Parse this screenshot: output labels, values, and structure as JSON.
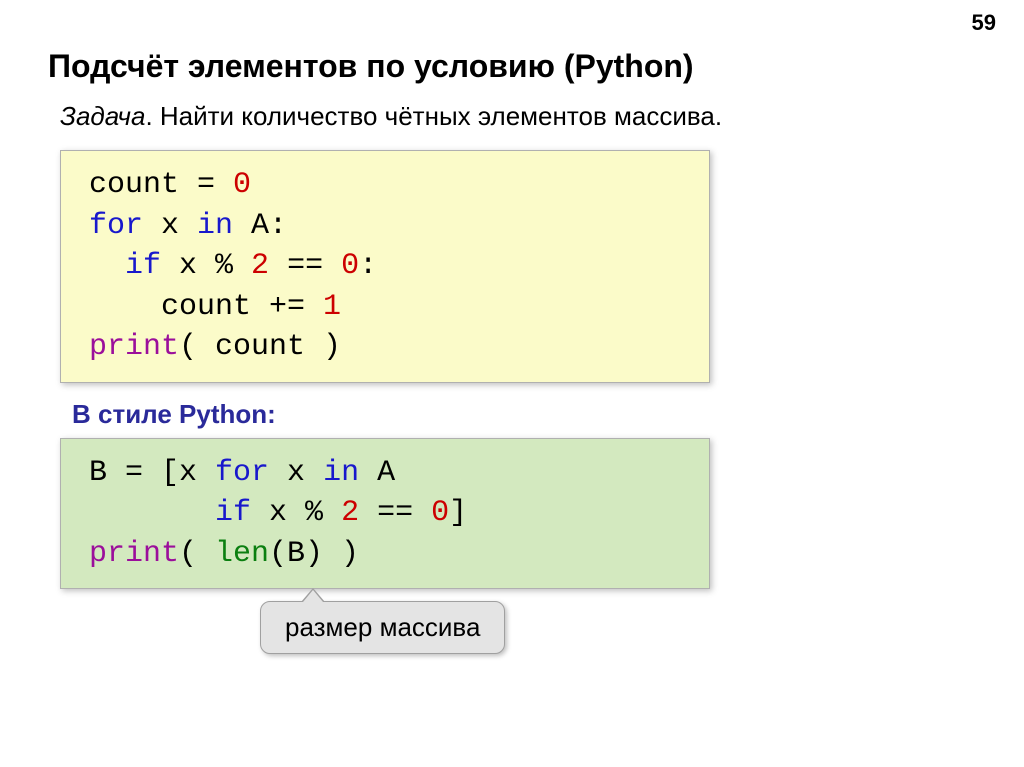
{
  "page_number": "59",
  "title": "Подсчёт элементов по условию (Python)",
  "task_label": "Задача",
  "task_text": ". Найти количество чётных элементов массива.",
  "code1": {
    "l1_a": "count = ",
    "l1_b": "0",
    "l2_a": "for",
    "l2_b": " x ",
    "l2_c": "in",
    "l2_d": " A:",
    "l3_a": "  ",
    "l3_b": "if",
    "l3_c": " x % ",
    "l3_d": "2",
    "l3_e": " == ",
    "l3_f": "0",
    "l3_g": ":",
    "l4_a": "    count += ",
    "l4_b": "1",
    "l5_a": "print",
    "l5_b": "( count )"
  },
  "subtitle": "В стиле Python:",
  "code2": {
    "l1_a": "B = [x ",
    "l1_b": "for",
    "l1_c": " x ",
    "l1_d": "in",
    "l1_e": " A",
    "l2_a": "       ",
    "l2_b": "if",
    "l2_c": " x % ",
    "l2_d": "2",
    "l2_e": " == ",
    "l2_f": "0",
    "l2_g": "]",
    "l3_a": "print",
    "l3_b": "( ",
    "l3_c": "len",
    "l3_d": "(B) )"
  },
  "callout": "размер массива"
}
